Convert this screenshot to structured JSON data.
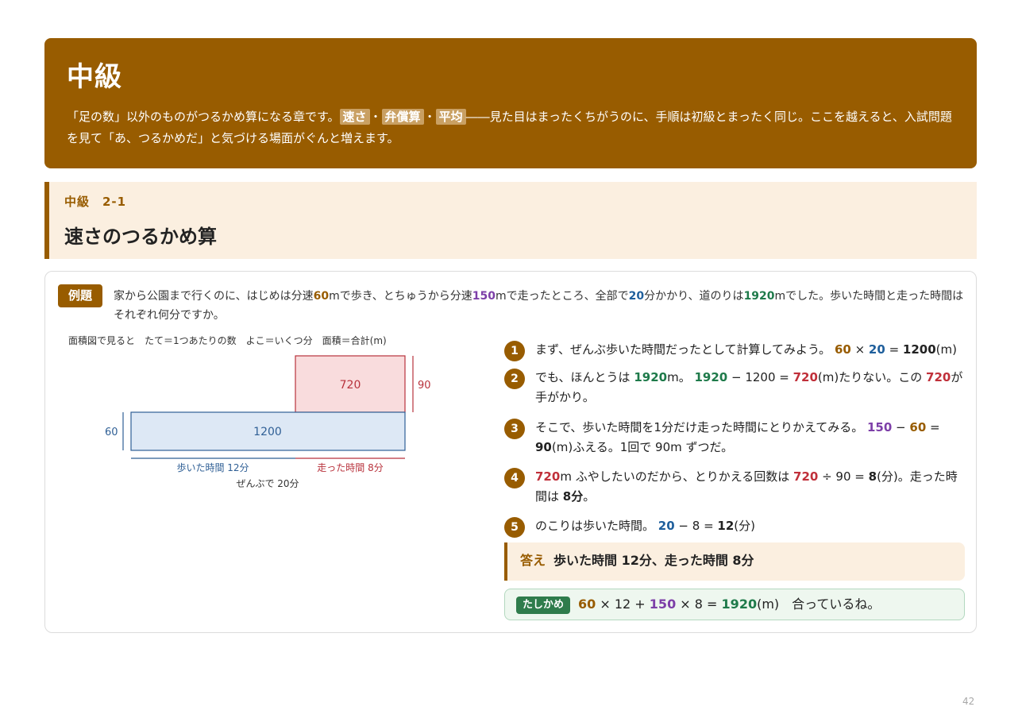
{
  "banner": {
    "title": "中級",
    "desc_1": "「足の数」以外のものがつるかめ算になる章です。",
    "tag_1": "速さ",
    "sep_1": "・",
    "tag_2": "弁償算",
    "sep_2": "・",
    "tag_3": "平均",
    "desc_2": "――見た目はまったくちがうのに、手順は初級とまったく同じ。ここを越えると、入試問題を見て「あ、つるかめだ」と気づける場面がぐんと増えます。"
  },
  "section": {
    "number": "中級　2-1",
    "title": "速さのつるかめ算"
  },
  "example": {
    "badge": "例題",
    "p1": "家から公園まで行くのに、はじめは分速",
    "v1": "60",
    "p2": "mで歩き、とちゅうから分速",
    "v2": "150",
    "p3": "mで走ったところ、全部で",
    "v3": "20",
    "p4": "分かかり、道のりは",
    "v4": "1920",
    "p5": "mでした。歩いた時間と走った時間はそれぞれ何分ですか。"
  },
  "diagram": {
    "caption": "面積図で見ると　たて＝1つあたりの数　よこ＝いくつ分　面積＝合計(m)",
    "walk_area": "1200",
    "run_extra_area": "720",
    "walk_height": "60",
    "extra_height": "90",
    "walk_time": "歩いた時間 12分",
    "run_time": "走った時間 8分",
    "total_time": "ぜんぶで 20分",
    "colors": {
      "walk_fill": "#dde8f5",
      "walk_stroke": "#2f5f95",
      "run_fill": "#f9dcdd",
      "run_stroke": "#b8323c"
    }
  },
  "steps": [
    {
      "num": "1",
      "text": "まず、ぜんぶ歩いた時間だったとして計算してみよう。",
      "a": "60",
      "op1": " × ",
      "b": "20",
      "op2": " = ",
      "r": "1200",
      "tail": "(m)"
    },
    {
      "num": "2",
      "t1": "でも、ほんとうは ",
      "a": "1920",
      "t2": "m。 ",
      "b": "1920",
      "t3": " − 1200 = ",
      "c": "720",
      "t4": "(m)たりない。この ",
      "d": "720",
      "t5": "が手がかり。"
    },
    {
      "num": "3",
      "t1": "そこで、歩いた時間を1分だけ走った時間にとりかえてみる。 ",
      "a": "150",
      "t2": " − ",
      "b": "60",
      "t3": " = ",
      "c": "90",
      "t4": "(m)ふえる。1回で 90m ずつだ。"
    },
    {
      "num": "4",
      "a": "720",
      "t1": "m ふやしたいのだから、とりかえる回数は ",
      "b": "720",
      "t2": " ÷ 90 = ",
      "c": "8",
      "t3": "(分)。走った時間は ",
      "d": "8分",
      "t4": "。"
    },
    {
      "num": "5",
      "t1": "のこりは歩いた時間。 ",
      "a": "20",
      "t2": " − 8 = ",
      "b": "12",
      "t3": "(分)"
    }
  ],
  "answer": {
    "label": "答え",
    "text": "歩いた時間 12分、走った時間 8分"
  },
  "check": {
    "label": "たしかめ",
    "a": "60",
    "t1": " × 12 + ",
    "b": "150",
    "t2": " × 8 = ",
    "c": "1920",
    "t3": "(m)　合っているね。"
  },
  "page_number": "42"
}
